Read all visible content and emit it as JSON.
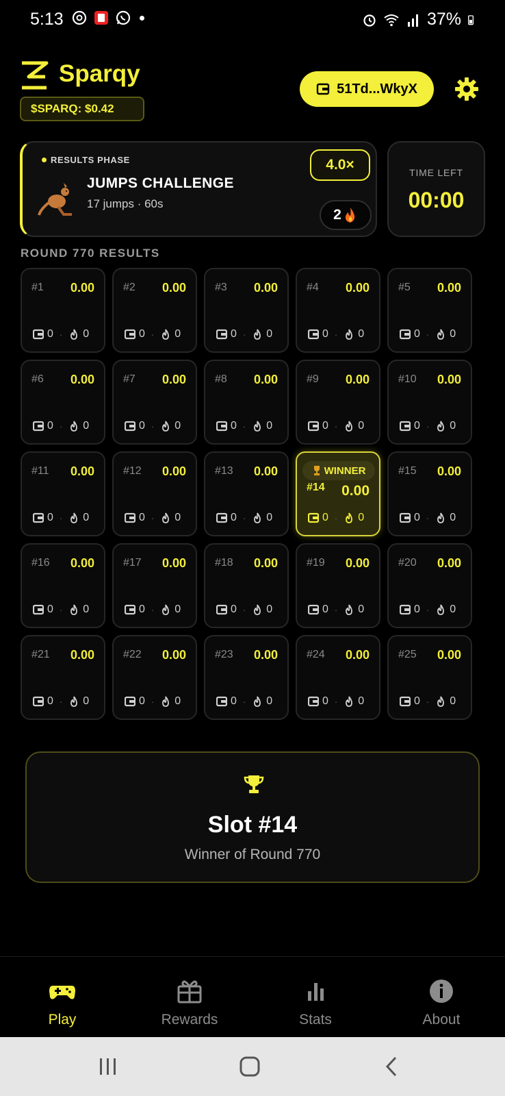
{
  "status_bar": {
    "time": "5:13",
    "battery": "37%",
    "icons": [
      "threads-icon",
      "app-notification-icon",
      "whatsapp-icon",
      "alarm-icon",
      "wifi-icon",
      "signal-icon",
      "battery-icon"
    ]
  },
  "header": {
    "brand": "Sparqy",
    "token_price": "$SPARQ: $0.42",
    "wallet_label": "51Td...WkyX"
  },
  "challenge": {
    "phase": "RESULTS PHASE",
    "title": "JUMPS CHALLENGE",
    "subtitle": "17 jumps · 60s",
    "multiplier": "4.0×",
    "streak": "2"
  },
  "timer": {
    "label": "TIME LEFT",
    "value": "00:00"
  },
  "results": {
    "title": "ROUND 770 RESULTS",
    "winner_tag": "WINNER",
    "slots": [
      {
        "num": "#1",
        "value": "0.00",
        "wallets": "0",
        "burns": "0"
      },
      {
        "num": "#2",
        "value": "0.00",
        "wallets": "0",
        "burns": "0"
      },
      {
        "num": "#3",
        "value": "0.00",
        "wallets": "0",
        "burns": "0"
      },
      {
        "num": "#4",
        "value": "0.00",
        "wallets": "0",
        "burns": "0"
      },
      {
        "num": "#5",
        "value": "0.00",
        "wallets": "0",
        "burns": "0"
      },
      {
        "num": "#6",
        "value": "0.00",
        "wallets": "0",
        "burns": "0"
      },
      {
        "num": "#7",
        "value": "0.00",
        "wallets": "0",
        "burns": "0"
      },
      {
        "num": "#8",
        "value": "0.00",
        "wallets": "0",
        "burns": "0"
      },
      {
        "num": "#9",
        "value": "0.00",
        "wallets": "0",
        "burns": "0"
      },
      {
        "num": "#10",
        "value": "0.00",
        "wallets": "0",
        "burns": "0"
      },
      {
        "num": "#11",
        "value": "0.00",
        "wallets": "0",
        "burns": "0"
      },
      {
        "num": "#12",
        "value": "0.00",
        "wallets": "0",
        "burns": "0"
      },
      {
        "num": "#13",
        "value": "0.00",
        "wallets": "0",
        "burns": "0"
      },
      {
        "num": "#14",
        "value": "0.00",
        "wallets": "0",
        "burns": "0",
        "winner": true
      },
      {
        "num": "#15",
        "value": "0.00",
        "wallets": "0",
        "burns": "0"
      },
      {
        "num": "#16",
        "value": "0.00",
        "wallets": "0",
        "burns": "0"
      },
      {
        "num": "#17",
        "value": "0.00",
        "wallets": "0",
        "burns": "0"
      },
      {
        "num": "#18",
        "value": "0.00",
        "wallets": "0",
        "burns": "0"
      },
      {
        "num": "#19",
        "value": "0.00",
        "wallets": "0",
        "burns": "0"
      },
      {
        "num": "#20",
        "value": "0.00",
        "wallets": "0",
        "burns": "0"
      },
      {
        "num": "#21",
        "value": "0.00",
        "wallets": "0",
        "burns": "0"
      },
      {
        "num": "#22",
        "value": "0.00",
        "wallets": "0",
        "burns": "0"
      },
      {
        "num": "#23",
        "value": "0.00",
        "wallets": "0",
        "burns": "0"
      },
      {
        "num": "#24",
        "value": "0.00",
        "wallets": "0",
        "burns": "0"
      },
      {
        "num": "#25",
        "value": "0.00",
        "wallets": "0",
        "burns": "0"
      }
    ]
  },
  "winner_card": {
    "slot": "Slot #14",
    "subtitle": "Winner of Round 770"
  },
  "bottom_nav": {
    "items": [
      {
        "label": "Play",
        "icon": "gamepad-icon",
        "active": true
      },
      {
        "label": "Rewards",
        "icon": "gift-icon",
        "active": false
      },
      {
        "label": "Stats",
        "icon": "bar-chart-icon",
        "active": false
      },
      {
        "label": "About",
        "icon": "info-icon",
        "active": false
      }
    ]
  },
  "colors": {
    "accent": "#f3ef3a",
    "background": "#000000",
    "card": "#0f0f0f",
    "muted": "#8c8c8c"
  }
}
